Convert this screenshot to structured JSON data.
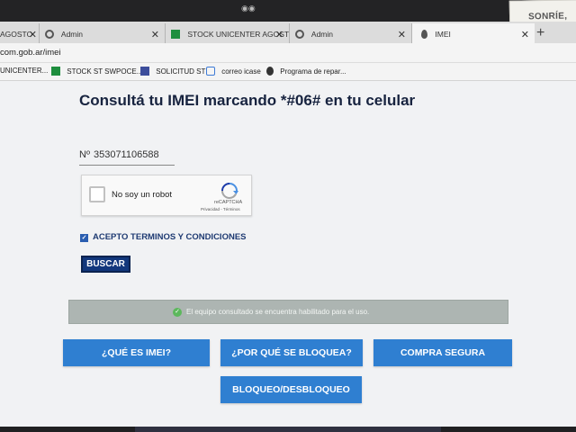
{
  "bezel": {
    "sticky_note": "SONRÍE, TE"
  },
  "tabs": [
    {
      "label": "AGOSTO",
      "icon": "sheet-icon",
      "closable": true
    },
    {
      "label": "Admin",
      "icon": "globe-icon",
      "closable": true
    },
    {
      "label": "STOCK UNICENTER AGOSTO",
      "icon": "sheet-icon",
      "closable": true
    },
    {
      "label": "Admin",
      "icon": "globe-icon",
      "closable": true
    },
    {
      "label": "IMEI",
      "icon": "drop-icon",
      "closable": true,
      "active": true
    }
  ],
  "newtab_label": "+",
  "address_bar": {
    "url": "com.gob.ar/imei"
  },
  "bookmarks": [
    {
      "label": "UNICENTER...",
      "icon": "none"
    },
    {
      "label": "STOCK ST SWPOCE...",
      "icon": "sheet-icon"
    },
    {
      "label": "SOLICITUD ST",
      "icon": "form-icon"
    },
    {
      "label": "correo icase",
      "icon": "mail-icon"
    },
    {
      "label": "Programa de repar...",
      "icon": "apple-icon"
    }
  ],
  "page": {
    "heading": "Consultá tu IMEI marcando *#06# en tu celular",
    "imei_prefix": "Nº",
    "imei_value": "353071106588",
    "captcha": {
      "label": "No soy un robot",
      "brand": "reCAPTCHA",
      "legal": "Privacidad - Términos",
      "checked": false
    },
    "terms_label": "ACEPTO TERMINOS Y CONDICIONES",
    "terms_checked": true,
    "search_button": "BUSCAR",
    "status_message": "El equipo consultado se encuentra habilitado para el uso.",
    "nav_buttons": [
      {
        "label": "¿QUÉ ES IMEI?"
      },
      {
        "label": "¿POR QUÉ SE BLOQUEA?"
      },
      {
        "label": "COMPRA SEGURA"
      },
      {
        "label": "BLOQUEO/DESBLOQUEO"
      }
    ]
  },
  "colors": {
    "heading": "#17233f",
    "search_button": "#12377c",
    "nav_button": "#2f7fd1",
    "status_bg": "#adb5b2",
    "status_ok": "#5cb85c"
  }
}
